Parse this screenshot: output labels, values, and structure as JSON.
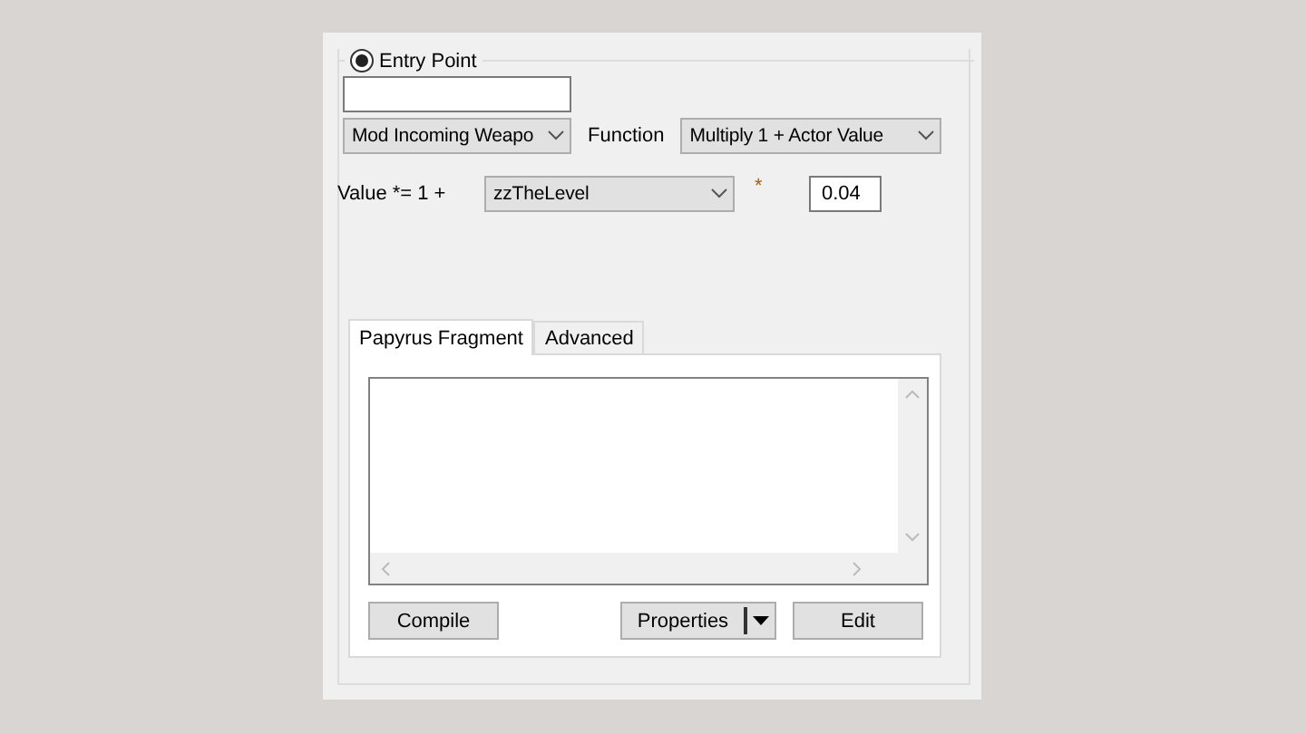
{
  "entry_point": {
    "label": "Entry Point",
    "selected": true
  },
  "entry_point_dropdown": {
    "value": "Mod Incoming Weapo"
  },
  "function_label": "Function",
  "function_dropdown": {
    "value": "Multiply 1 + Actor Value"
  },
  "value_label": "Value *= 1 +",
  "actor_value_dropdown": {
    "value": "zzTheLevel"
  },
  "multiply_label": "*",
  "factor_field": {
    "value": "0.04"
  },
  "tabs": [
    {
      "label": "Papyrus Fragment",
      "selected": true
    },
    {
      "label": "Advanced",
      "selected": false
    }
  ],
  "buttons": [
    {
      "label": "Compile",
      "kind": "plain"
    },
    {
      "label": "Properties",
      "kind": "split"
    },
    {
      "label": "Edit",
      "kind": "plain"
    }
  ]
}
